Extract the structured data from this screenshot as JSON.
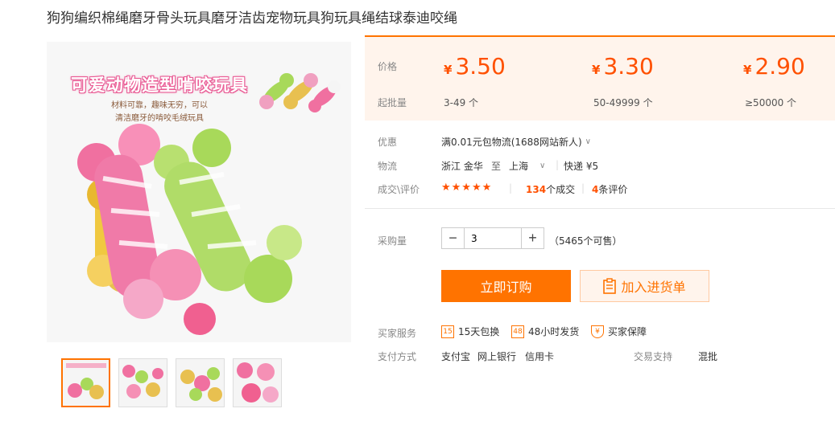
{
  "product": {
    "title": "狗狗编织棉绳磨牙骨头玩具磨牙洁齿宠物玩具狗玩具绳结球泰迪咬绳",
    "image_banner": "可爱动物造型啃咬玩具",
    "image_slogan_line1": "材料可靠，趣味无穷，可以",
    "image_slogan_line2": "清洁磨牙的啃咬毛绒玩具"
  },
  "pricing": {
    "price_label": "价格",
    "batch_label": "起批量",
    "currency": "¥",
    "tiers": [
      {
        "price": "3.50",
        "qty": "3-49 个"
      },
      {
        "price": "3.30",
        "qty": "50-49999 个"
      },
      {
        "price": "2.90",
        "qty": "≥50000 个"
      }
    ]
  },
  "info": {
    "promo_label": "优惠",
    "promo_value": "满0.01元包物流(1688网站新人)",
    "logistics_label": "物流",
    "from": "浙江 金华",
    "to_word": "至",
    "to": "上海",
    "express": "快递 ¥5",
    "deals_label": "成交\\评价",
    "stars": "★★★★★",
    "deal_count": "134",
    "deal_suffix": "个成交",
    "review_count": "4",
    "review_suffix": "条评价"
  },
  "purchase": {
    "qty_label": "采购量",
    "minus": "−",
    "plus": "+",
    "qty_value": "3",
    "stock": "（5465个可售）",
    "buy_label": "立即订购",
    "cart_label": "加入进货单"
  },
  "services": {
    "label": "买家服务",
    "items": [
      {
        "icon_text": "15",
        "label": "15天包换"
      },
      {
        "icon_text": "48",
        "label": "48小时发货"
      },
      {
        "icon_text": "¥",
        "label": "买家保障"
      }
    ]
  },
  "payment": {
    "label": "支付方式",
    "methods": [
      "支付宝",
      "网上银行",
      "信用卡"
    ],
    "trade_label": "交易支持",
    "trade_value": "混批"
  },
  "colors": {
    "accent": "#ff7300",
    "price": "#ff5000",
    "price_bg": "#fff4ec"
  }
}
